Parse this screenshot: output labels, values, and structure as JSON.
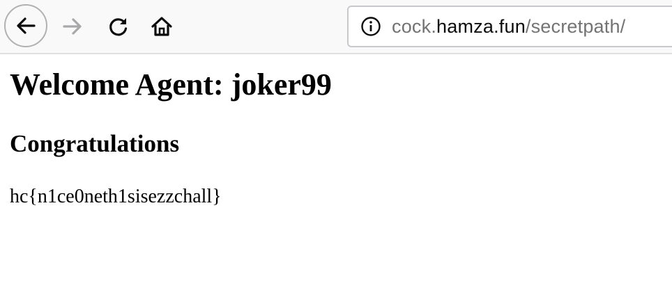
{
  "browser": {
    "icons": {
      "back": "back-arrow-icon",
      "forward": "forward-arrow-icon",
      "reload": "reload-icon",
      "home": "home-icon",
      "info": "info-icon"
    },
    "url": {
      "prefix": "cock.",
      "host": "hamza.fun",
      "path": "/secretpath/"
    }
  },
  "page": {
    "heading": "Welcome Agent: joker99",
    "subheading": "Congratulations",
    "flag_text": "hc{n1ce0neth1sisezzchall}"
  }
}
